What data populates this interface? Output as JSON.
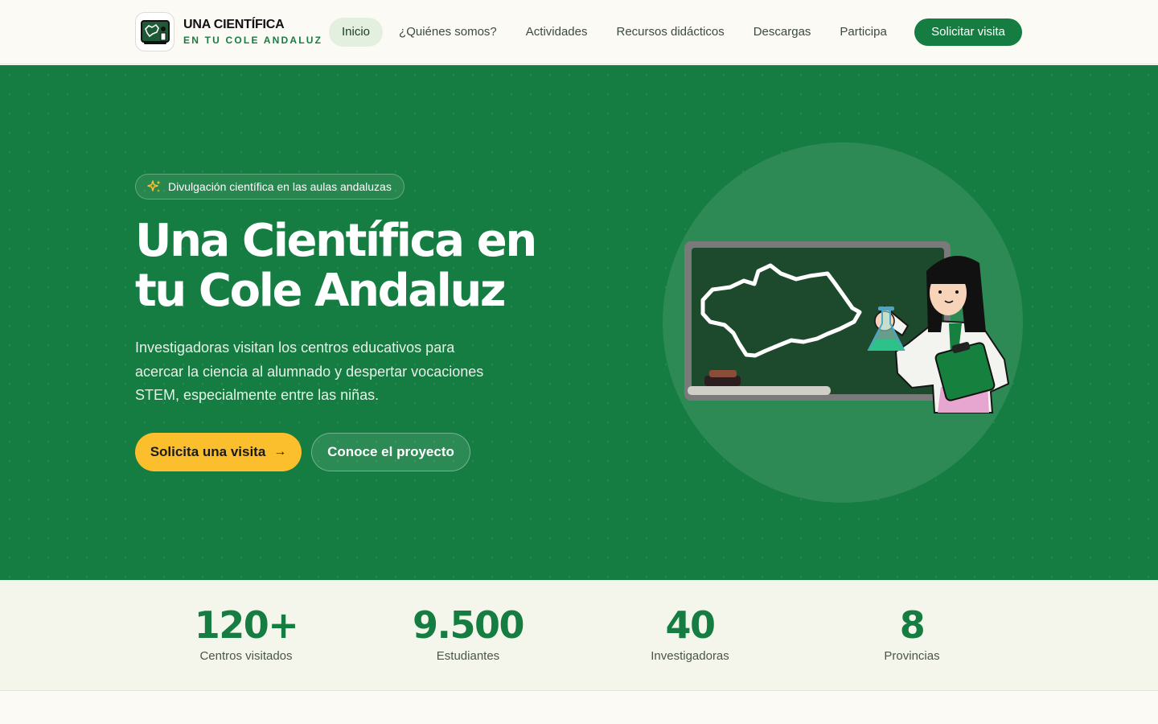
{
  "brand": {
    "name_line1": "UNA CIENTÍFICA",
    "name_line2": "EN TU COLE ANDALUZ",
    "logo_icon": "chalkboard-icon"
  },
  "nav": {
    "items": [
      {
        "label": "Inicio",
        "active": true
      },
      {
        "label": "¿Quiénes somos?",
        "active": false
      },
      {
        "label": "Actividades",
        "active": false
      },
      {
        "label": "Recursos didácticos",
        "active": false
      },
      {
        "label": "Descargas",
        "active": false
      },
      {
        "label": "Participa",
        "active": false
      }
    ],
    "cta_label": "Solicitar visita"
  },
  "hero": {
    "badge_text": "Divulgación científica en las aulas andaluzas",
    "badge_icon": "sparkles-icon",
    "title_line1": "Una Científica en",
    "title_line2": "tu Cole Andaluz",
    "description": "Investigadoras visitan los centros educativos para acercar la ciencia al alumnado y despertar vocaciones STEM, especialmente entre las niñas.",
    "primary_button": "Solicita una visita",
    "primary_button_icon": "arrow-right-icon",
    "secondary_button": "Conoce el proyecto"
  },
  "stats": [
    {
      "value": "120+",
      "label": "Centros visitados"
    },
    {
      "value": "9.500",
      "label": "Estudiantes"
    },
    {
      "value": "40",
      "label": "Investigadoras"
    },
    {
      "value": "8",
      "label": "Provincias"
    }
  ],
  "colors": {
    "primary_green": "#157d41",
    "accent_yellow": "#fbbf2e",
    "background": "#fbfaf5",
    "stats_background": "#f4f6ec"
  }
}
